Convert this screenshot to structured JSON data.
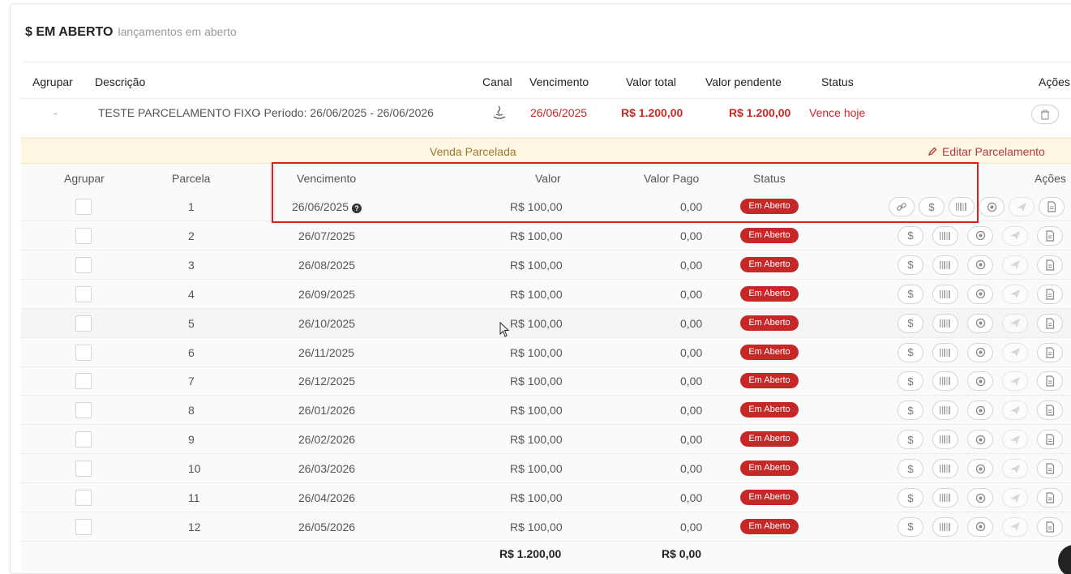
{
  "header": {
    "title": "$ EM ABERTO",
    "subtitle": "lançamentos em aberto"
  },
  "main_table": {
    "columns": {
      "agrupar": "Agrupar",
      "descricao": "Descrição",
      "canal": "Canal",
      "vencimento": "Vencimento",
      "valor_total": "Valor total",
      "valor_pendente": "Valor pendente",
      "status": "Status",
      "acoes": "Ações"
    },
    "row": {
      "agrupar": "-",
      "descricao": "TESTE PARCELAMENTO FIXO",
      "periodo": "- Período: 26/06/2025 - 26/06/2026",
      "vencimento": "26/06/2025",
      "valor_total": "R$ 1.200,00",
      "valor_pendente": "R$ 1.200,00",
      "status": "Vence hoje"
    }
  },
  "installments": {
    "banner": "Venda Parcelada",
    "edit_label": "Editar Parcelamento",
    "columns": {
      "agrupar": "Agrupar",
      "parcela": "Parcela",
      "vencimento": "Vencimento",
      "valor": "Valor",
      "valor_pago": "Valor Pago",
      "status": "Status",
      "acoes": "Ações"
    },
    "rows": [
      {
        "parcela": "1",
        "vencimento": "26/06/2025",
        "valor": "R$ 100,00",
        "valor_pago": "0,00",
        "status": "Em Aberto"
      },
      {
        "parcela": "2",
        "vencimento": "26/07/2025",
        "valor": "R$ 100,00",
        "valor_pago": "0,00",
        "status": "Em Aberto"
      },
      {
        "parcela": "3",
        "vencimento": "26/08/2025",
        "valor": "R$ 100,00",
        "valor_pago": "0,00",
        "status": "Em Aberto"
      },
      {
        "parcela": "4",
        "vencimento": "26/09/2025",
        "valor": "R$ 100,00",
        "valor_pago": "0,00",
        "status": "Em Aberto"
      },
      {
        "parcela": "5",
        "vencimento": "26/10/2025",
        "valor": "R$ 100,00",
        "valor_pago": "0,00",
        "status": "Em Aberto"
      },
      {
        "parcela": "6",
        "vencimento": "26/11/2025",
        "valor": "R$ 100,00",
        "valor_pago": "0,00",
        "status": "Em Aberto"
      },
      {
        "parcela": "7",
        "vencimento": "26/12/2025",
        "valor": "R$ 100,00",
        "valor_pago": "0,00",
        "status": "Em Aberto"
      },
      {
        "parcela": "8",
        "vencimento": "26/01/2026",
        "valor": "R$ 100,00",
        "valor_pago": "0,00",
        "status": "Em Aberto"
      },
      {
        "parcela": "9",
        "vencimento": "26/02/2026",
        "valor": "R$ 100,00",
        "valor_pago": "0,00",
        "status": "Em Aberto"
      },
      {
        "parcela": "10",
        "vencimento": "26/03/2026",
        "valor": "R$ 100,00",
        "valor_pago": "0,00",
        "status": "Em Aberto"
      },
      {
        "parcela": "11",
        "vencimento": "26/04/2026",
        "valor": "R$ 100,00",
        "valor_pago": "0,00",
        "status": "Em Aberto"
      },
      {
        "parcela": "12",
        "vencimento": "26/05/2026",
        "valor": "R$ 100,00",
        "valor_pago": "0,00",
        "status": "Em Aberto"
      }
    ],
    "totals": {
      "valor": "R$ 1.200,00",
      "valor_pago": "R$ 0,00"
    }
  },
  "colors": {
    "accent_red": "#c62828",
    "banner_bg": "#fdf6e3",
    "banner_text": "#9c7a2a",
    "highlight": "#e21d1d"
  }
}
